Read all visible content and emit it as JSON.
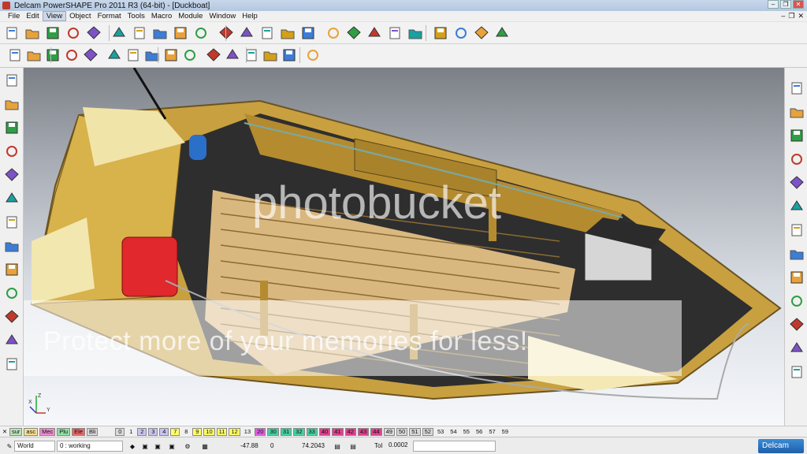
{
  "window": {
    "title": "Delcam PowerSHAPE Pro 2011 R3 (64-bit) - [Duckboat]"
  },
  "menu": {
    "items": [
      "File",
      "Edit",
      "View",
      "Object",
      "Format",
      "Tools",
      "Macro",
      "Module",
      "Window",
      "Help"
    ],
    "active": "View"
  },
  "toolbar1": {
    "icons": [
      "new-icon",
      "open-icon",
      "open-recent-icon",
      "save-icon",
      "print-icon",
      "cut-icon",
      "copy-icon",
      "paste-icon",
      "edit-icon",
      "delete-icon",
      "undo-icon",
      "redo-icon",
      "redo-alt-icon",
      "select-icon",
      "point-icon",
      "line-icon",
      "arc-icon",
      "curve-icon",
      "text-icon",
      "surface-icon",
      "solid-icon",
      "symbol-icon",
      "assembly-icon",
      "wizard-icon"
    ]
  },
  "toolbar2": {
    "icons": [
      "view-iso-icon",
      "view-top-icon",
      "view-front-icon",
      "view-rotate-icon",
      "view-pan-icon",
      "shade-icon",
      "wireframe-icon",
      "hidden-icon",
      "shaded-edges-icon",
      "section-icon",
      "render-icon",
      "measure-icon",
      "analyse-icon",
      "material-icon",
      "light-icon",
      "camera-icon"
    ]
  },
  "leftbar": {
    "icons": [
      "select-arrow-icon",
      "rotate-view-icon",
      "workplane-icon",
      "axis-icon",
      "surface-tool-icon",
      "solid-tool-icon",
      "feature-icon",
      "cube-icon",
      "array-icon",
      "morph-icon",
      "offset-icon",
      "sphere-icon",
      "mirror-icon"
    ]
  },
  "rightbar": {
    "icons": [
      "view-iso1-icon",
      "view-iso2-icon",
      "view-iso3-icon",
      "view-iso4-icon",
      "view-top2-icon",
      "view-spin-icon",
      "zoom-icon",
      "zoom-fit-icon",
      "globe-icon",
      "shaded-sphere-icon",
      "pyramid-icon",
      "spin-model-icon",
      "material-sphere-icon"
    ]
  },
  "watermark": {
    "logo": "photobucket",
    "banner": "Protect more of your memories for less!"
  },
  "axes": {
    "x": "X",
    "y": "Y",
    "z": "Z"
  },
  "layers": {
    "tags": [
      {
        "label": "sur",
        "color": "#b9e4b9"
      },
      {
        "label": "asc",
        "color": "#f7e08f"
      },
      {
        "label": "Mec",
        "color": "#f08bd0"
      },
      {
        "label": "Plu",
        "color": "#8fe0a5"
      },
      {
        "label": "Ele",
        "color": "#e86868"
      },
      {
        "label": "Bli",
        "color": "#d8d8d8"
      }
    ],
    "numbers": [
      {
        "n": "0",
        "c": "#d9d9d9"
      },
      {
        "n": "1",
        "c": ""
      },
      {
        "n": "2",
        "c": "#c8c4f0"
      },
      {
        "n": "3",
        "c": "#c8c4f0"
      },
      {
        "n": "4",
        "c": "#c8c4f0"
      },
      {
        "n": "7",
        "c": "#ffff66"
      },
      {
        "n": "8",
        "c": ""
      },
      {
        "n": "9",
        "c": "#ffff66"
      },
      {
        "n": "10",
        "c": "#ffff66"
      },
      {
        "n": "11",
        "c": "#ffff66"
      },
      {
        "n": "12",
        "c": "#ffff66"
      },
      {
        "n": "13",
        "c": ""
      },
      {
        "n": "20",
        "c": "#e05ee0"
      },
      {
        "n": "30",
        "c": "#44d0a0"
      },
      {
        "n": "31",
        "c": "#44d0a0"
      },
      {
        "n": "32",
        "c": "#44d0a0"
      },
      {
        "n": "33",
        "c": "#44d0a0"
      },
      {
        "n": "40",
        "c": "#e04090"
      },
      {
        "n": "41",
        "c": "#e04090"
      },
      {
        "n": "42",
        "c": "#e04090"
      },
      {
        "n": "43",
        "c": "#e04090"
      },
      {
        "n": "44",
        "c": "#e04090"
      },
      {
        "n": "49",
        "c": "#d9d9d9"
      },
      {
        "n": "50",
        "c": "#d9d9d9"
      },
      {
        "n": "51",
        "c": "#d9d9d9"
      },
      {
        "n": "52",
        "c": "#d9d9d9"
      },
      {
        "n": "53",
        "c": ""
      },
      {
        "n": "54",
        "c": ""
      },
      {
        "n": "55",
        "c": ""
      },
      {
        "n": "56",
        "c": ""
      },
      {
        "n": "57",
        "c": ""
      },
      {
        "n": "59",
        "c": ""
      }
    ]
  },
  "status": {
    "workplane": "World",
    "level": "0 : working",
    "x": "-47.88",
    "y": "0",
    "z": "74.2043",
    "tol_label": "Tol",
    "tol": "0.0002",
    "brand": "Delcam"
  }
}
